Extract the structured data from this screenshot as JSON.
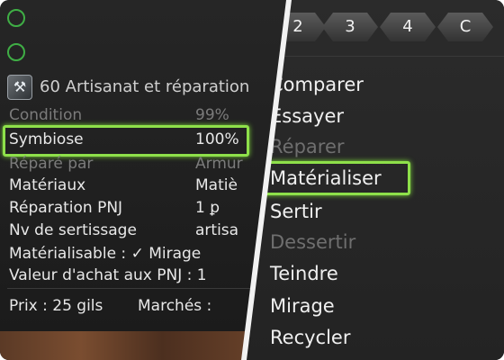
{
  "item": {
    "title": "60 Artisanat et réparation",
    "icon": "armor-icon"
  },
  "stats": [
    {
      "label": "Condition",
      "value": "99%",
      "dim": true
    },
    {
      "label": "Symbiose",
      "value": "100%",
      "dim": false
    },
    {
      "label": "Réparé par",
      "value": "Armur",
      "dim": true
    },
    {
      "label": "Matériaux",
      "value": "Matiè",
      "dim": false
    },
    {
      "label": "Réparation PNJ",
      "value": "1 ꝑ",
      "dim": false
    },
    {
      "label": "Nv de sertissage",
      "value": "artisa",
      "dim": false
    }
  ],
  "extra_lines": {
    "materialisable": "Matérialisable : ✓  Mirage",
    "sale_value": "Valeur d'achat aux PNJ : 1",
    "price": "Prix : 25 gils",
    "markets": "Marchés :"
  },
  "tabs": [
    "2",
    "3",
    "4",
    "C"
  ],
  "menu": [
    {
      "label": "Comparer",
      "enabled": true
    },
    {
      "label": "Essayer",
      "enabled": true
    },
    {
      "label": "Réparer",
      "enabled": false
    },
    {
      "label": "Matérialiser",
      "enabled": true
    },
    {
      "label": "Sertir",
      "enabled": true
    },
    {
      "label": "Dessertir",
      "enabled": false
    },
    {
      "label": "Teindre",
      "enabled": true
    },
    {
      "label": "Mirage",
      "enabled": true
    },
    {
      "label": "Recycler",
      "enabled": true
    }
  ],
  "colors": {
    "highlight": "#8ee04a",
    "slot_circle": "#3fae45"
  }
}
